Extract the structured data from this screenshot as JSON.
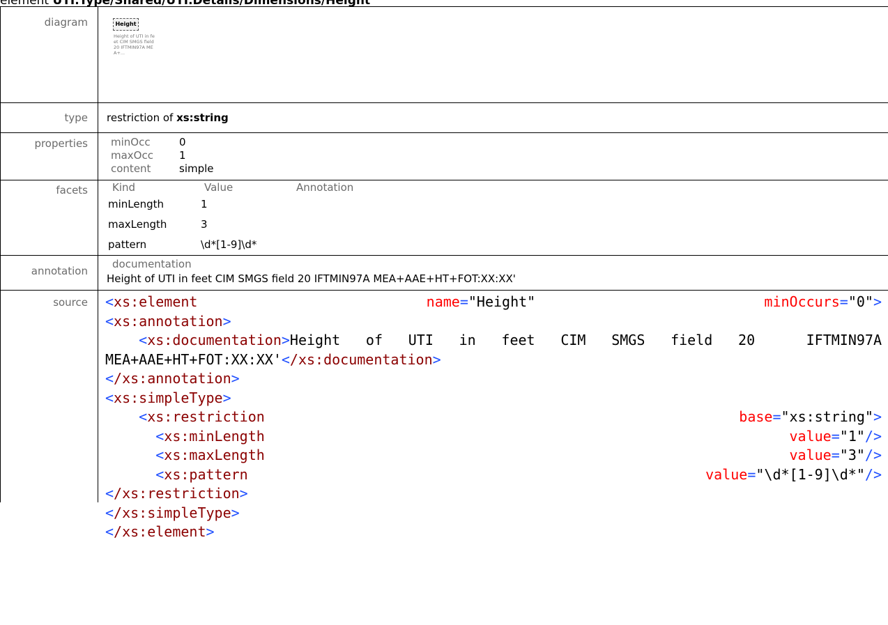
{
  "header": {
    "prefix": "element ",
    "path": "UTI.Type/Shared/UTI.Details/Dimensions/Height"
  },
  "labels": {
    "diagram": "diagram",
    "type": "type",
    "properties": "properties",
    "facets": "facets",
    "annotation": "annotation",
    "source": "source"
  },
  "diagram": {
    "box_label": "Height",
    "doc_preview": "Height of UTI in feet CIM SMGS field 20 IFTMIN97A MEA+..."
  },
  "type": {
    "prefix": "restriction of ",
    "base": "xs:string"
  },
  "properties": [
    {
      "key": "minOcc",
      "value": "0"
    },
    {
      "key": "maxOcc",
      "value": "1"
    },
    {
      "key": "content",
      "value": "simple"
    }
  ],
  "facets": {
    "headers": [
      "Kind",
      "Value",
      "Annotation"
    ],
    "rows": [
      {
        "kind": "minLength",
        "value": "1"
      },
      {
        "kind": "maxLength",
        "value": "3"
      },
      {
        "kind": "pattern",
        "value": "\\d*[1-9]\\d*"
      }
    ]
  },
  "annotation": {
    "label": "documentation",
    "text": "Height of UTI in feet CIM SMGS field 20  IFTMIN97A MEA+AAE+HT+FOT:XX:XX'"
  },
  "source": {
    "l1_tag": "xs:element",
    "l1_attr1": "name",
    "l1_val1": "\"Height\"",
    "l1_attr2": "minOccurs",
    "l1_val2": "\"0\"",
    "l2_tag": "xs:annotation",
    "l3_tag": "xs:documentation",
    "l3_text": "Height of UTI in feet CIM SMGS field 20  IFTMIN97A",
    "l4_text": "MEA+AAE+HT+FOT:XX:XX'",
    "l4_close": "/xs:documentation",
    "l5_close": "/xs:annotation",
    "l6_tag": "xs:simpleType",
    "l7_tag": "xs:restriction",
    "l7_attr": "base",
    "l7_val": "\"xs:string\"",
    "l8_tag": "xs:minLength",
    "l8_attr": "value",
    "l8_val": "\"1\"",
    "l9_tag": "xs:maxLength",
    "l9_attr": "value",
    "l9_val": "\"3\"",
    "l10_tag": "xs:pattern",
    "l10_attr": "value",
    "l10_val": "\"\\d*[1-9]\\d*\"",
    "l11_close": "/xs:restriction",
    "l12_close": "/xs:simpleType",
    "l13_close": "/xs:element"
  }
}
